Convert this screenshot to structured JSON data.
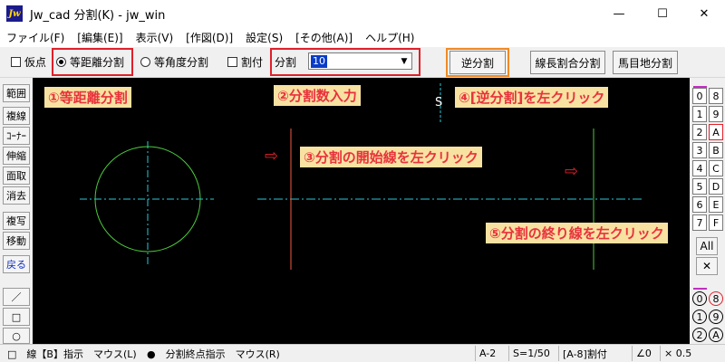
{
  "window": {
    "icon_text": "Jw",
    "title": "Jw_cad 分割(K) - jw_win",
    "minimize": "—",
    "maximize": "☐",
    "close": "✕"
  },
  "menu": [
    "ファイル(F)",
    "[編集(E)]",
    "表示(V)",
    "[作図(D)]",
    "設定(S)",
    "[その他(A)]",
    "ヘルプ(H)"
  ],
  "toolbar": {
    "kari_ten": "仮点",
    "tou_kyori": "等距離分割",
    "tou_kakudo": "等角度分割",
    "waritsuke": "割付",
    "bunkatsu_label": "分割",
    "bunkatsu_value": "10",
    "dropdown_arrow": "▼",
    "gyaku_bunkatsu": "逆分割",
    "senchou": "線長割合分割",
    "mamejiki": "馬目地分割"
  },
  "left_palette": {
    "btn1": "範囲",
    "btn2": "複線",
    "btn3": "ｺｰﾅｰ",
    "btn4": "伸縮",
    "btn5": "面取",
    "btn6": "消去",
    "btn7": "複写",
    "btn8": "移動",
    "btn9": "戻る",
    "line_icon": "／",
    "rect_icon": "□",
    "circle_icon": "○"
  },
  "canvas": {
    "note1": "①等距離分割",
    "note2": "②分割数入力",
    "note3": "③分割の開始線を左クリック",
    "note4": "④[逆分割]を左クリック",
    "note5": "⑤分割の終り線を左クリック",
    "s_mark": "S",
    "arrow_glyph": "⇨",
    "colors": {
      "circle_line": "#4ccc3c",
      "center_line": "#2cc8d8",
      "red_line": "#f05a40",
      "note_bg": "#f8e2a2",
      "note_text": "#e8323c"
    }
  },
  "right_palette": {
    "layer_left": [
      "0",
      "1",
      "2",
      "3",
      "4",
      "5",
      "6",
      "7"
    ],
    "layer_right": [
      "8",
      "9",
      "A",
      "B",
      "C",
      "D",
      "E",
      "F"
    ],
    "all": "All",
    "cross": "✕",
    "group_left": [
      "0",
      "1",
      "2"
    ],
    "group_right": [
      "8",
      "9",
      "A"
    ]
  },
  "status": {
    "left_mode": "□　線【B】指示　マウス(L)",
    "right_mode": "●　分割終点指示　マウス(R)",
    "paper": "A-2",
    "scale": "S=1/50",
    "layer": "[A-8]割付",
    "angle": "∠0",
    "zoom": "× 0.5"
  }
}
